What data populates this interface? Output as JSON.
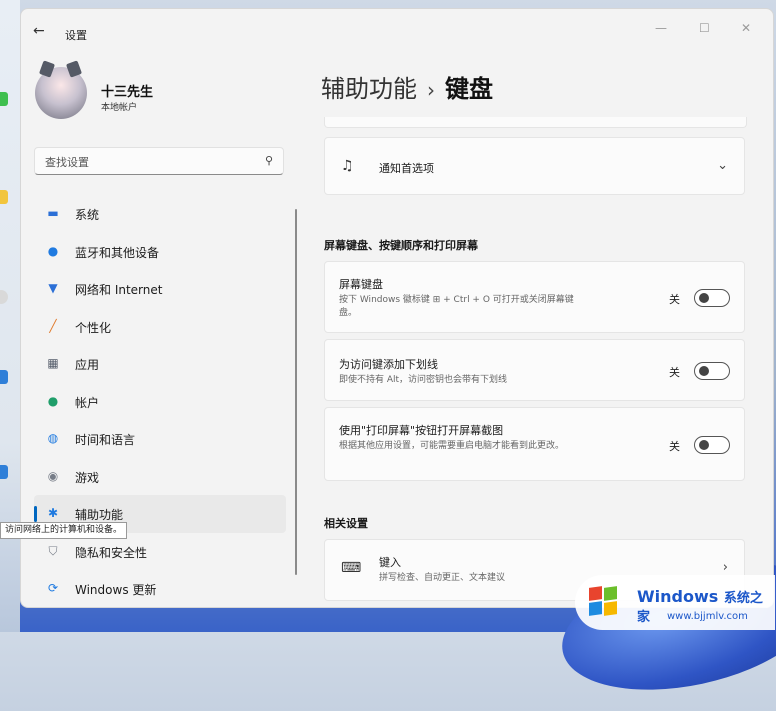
{
  "window": {
    "title": "设置"
  },
  "profile": {
    "name": "十三先生",
    "account_type": "本地帐户"
  },
  "search": {
    "placeholder": "查找设置"
  },
  "nav": {
    "items": [
      {
        "label": "系统",
        "icon": "monitor-icon",
        "color": "#2b6fd6"
      },
      {
        "label": "蓝牙和其他设备",
        "icon": "bluetooth-icon",
        "color": "#1f7ae0"
      },
      {
        "label": "网络和 Internet",
        "icon": "wifi-icon",
        "color": "#2b6fd6"
      },
      {
        "label": "个性化",
        "icon": "brush-icon",
        "color": "#e0792a"
      },
      {
        "label": "应用",
        "icon": "apps-icon",
        "color": "#555d6b"
      },
      {
        "label": "帐户",
        "icon": "person-icon",
        "color": "#1f9e6a"
      },
      {
        "label": "时间和语言",
        "icon": "globe-clock-icon",
        "color": "#1f7ae0"
      },
      {
        "label": "游戏",
        "icon": "gamepad-icon",
        "color": "#777d88"
      },
      {
        "label": "辅助功能",
        "icon": "accessibility-icon",
        "color": "#1f7ae0",
        "active": true
      },
      {
        "label": "隐私和安全性",
        "icon": "shield-icon",
        "color": "#777d88"
      },
      {
        "label": "Windows 更新",
        "icon": "update-icon",
        "color": "#1f7ae0"
      }
    ]
  },
  "tooltip": {
    "text": "访问网络上的计算机和设备。"
  },
  "breadcrumb": {
    "parent": "辅助功能",
    "separator": "›",
    "current": "键盘"
  },
  "notifications_card": {
    "title": "通知首选项"
  },
  "section_keyboard": {
    "title": "屏幕键盘、按键顺序和打印屏幕"
  },
  "settings": [
    {
      "title": "屏幕键盘",
      "desc": "按下 Windows 徽标键 ⊞ + Ctrl + O 可打开或关闭屏幕键盘。",
      "state": "关"
    },
    {
      "title": "为访问键添加下划线",
      "desc": "即使不持有 Alt，访问密钥也会带有下划线",
      "state": "关"
    },
    {
      "title": "使用\"打印屏幕\"按钮打开屏幕截图",
      "desc": "根据其他应用设置，可能需要重启电脑才能看到此更改。",
      "state": "关"
    }
  ],
  "section_related": {
    "title": "相关设置"
  },
  "typing_card": {
    "title": "键入",
    "desc": "拼写检查、自动更正、文本建议"
  },
  "watermark": {
    "brand": "Windows",
    "brand_cn": "系统之家",
    "url": "www.bjjmlv.com"
  },
  "accent": "#0067c0"
}
